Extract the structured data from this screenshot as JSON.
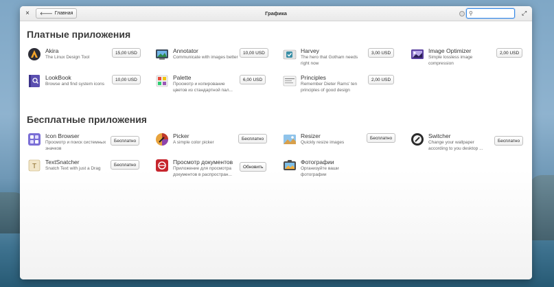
{
  "window": {
    "title": "Графика",
    "back_label": "Главная",
    "close_glyph": "×",
    "maximize_glyph": "⤢",
    "search": {
      "value": "",
      "placeholder": ""
    }
  },
  "paid": {
    "heading": "Платные приложения",
    "apps": [
      {
        "name": "Akira",
        "description": "The Linux Design Tool",
        "price": "15,00 USD",
        "icon": "akira-icon"
      },
      {
        "name": "Annotator",
        "description": "Communicate with images better",
        "price": "10,00 USD",
        "icon": "annotator-icon"
      },
      {
        "name": "Harvey",
        "description": "The hero that Gotham needs right now",
        "price": "3,00 USD",
        "icon": "harvey-icon"
      },
      {
        "name": "Image Optimizer",
        "description": "Simple lossless image compression",
        "price": "2,00 USD",
        "icon": "image-optimizer-icon"
      },
      {
        "name": "LookBook",
        "description": "Browse and find system icons",
        "price": "10,00 USD",
        "icon": "lookbook-icon"
      },
      {
        "name": "Palette",
        "description": "Просмотр и копирование цветов из стандартной пал...",
        "price": "6,00 USD",
        "icon": "palette-icon"
      },
      {
        "name": "Principles",
        "description": "Remember Dieter Rams' ten principles of good design",
        "price": "2,00 USD",
        "icon": "principles-icon"
      }
    ]
  },
  "free": {
    "heading": "Бесплатные приложения",
    "apps": [
      {
        "name": "Icon Browser",
        "description": "Просмотр и поиск системных значков",
        "price": "Бесплатно",
        "icon": "icon-browser-icon"
      },
      {
        "name": "Picker",
        "description": "A simple color picker",
        "price": "Бесплатно",
        "icon": "picker-icon"
      },
      {
        "name": "Resizer",
        "description": "Quickly resize images",
        "price": "Бесплатно",
        "icon": "resizer-icon"
      },
      {
        "name": "Switcher",
        "description": "Change your wallpaper according to you desktop ...",
        "price": "Бесплатно",
        "icon": "switcher-icon"
      },
      {
        "name": "TextSnatcher",
        "description": "Snatch Text with just a Drag",
        "price": "Бесплатно",
        "icon": "textsnatcher-icon"
      },
      {
        "name": "Просмотр документов",
        "description": "Приложение для просмотра документов в распростран...",
        "price": "Обновить",
        "icon": "document-viewer-icon"
      },
      {
        "name": "Фотографии",
        "description": "Организуйте ваши фотографии",
        "price": "",
        "icon": "photos-icon"
      }
    ]
  },
  "colors": {
    "accent": "#3689e6"
  }
}
